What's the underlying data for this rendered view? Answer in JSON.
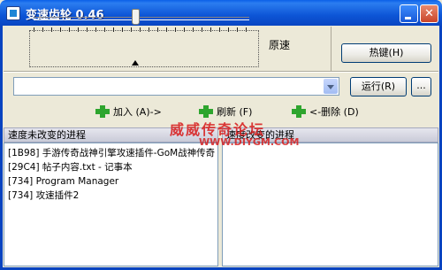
{
  "window": {
    "title": "变速齿轮 0.46"
  },
  "controls": {
    "minimize_glyph": "",
    "close_glyph": "✕"
  },
  "slider": {
    "label": "原速",
    "level": 0.47
  },
  "hotkey_button": "热键(H)",
  "combo": {
    "value": ""
  },
  "run_button": "运行(R)",
  "more_button": "...",
  "actions": {
    "add": "加入 (A)->",
    "refresh": "刷新 (F)",
    "remove": "<-删除 (D)"
  },
  "left_list": {
    "header": "速度未改变的进程",
    "items": [
      "[1B98]  手游传奇战神引擎攻速插件-GoM战神传奇",
      "[29C4]  帖子内容.txt - 记事本",
      "[734]  Program Manager",
      "[734]  攻速插件2"
    ]
  },
  "right_list": {
    "header": "速度改变的进程",
    "items": []
  },
  "watermark": {
    "line1": "威威传奇论坛",
    "line2": "WWW.DIYGM.COM"
  }
}
